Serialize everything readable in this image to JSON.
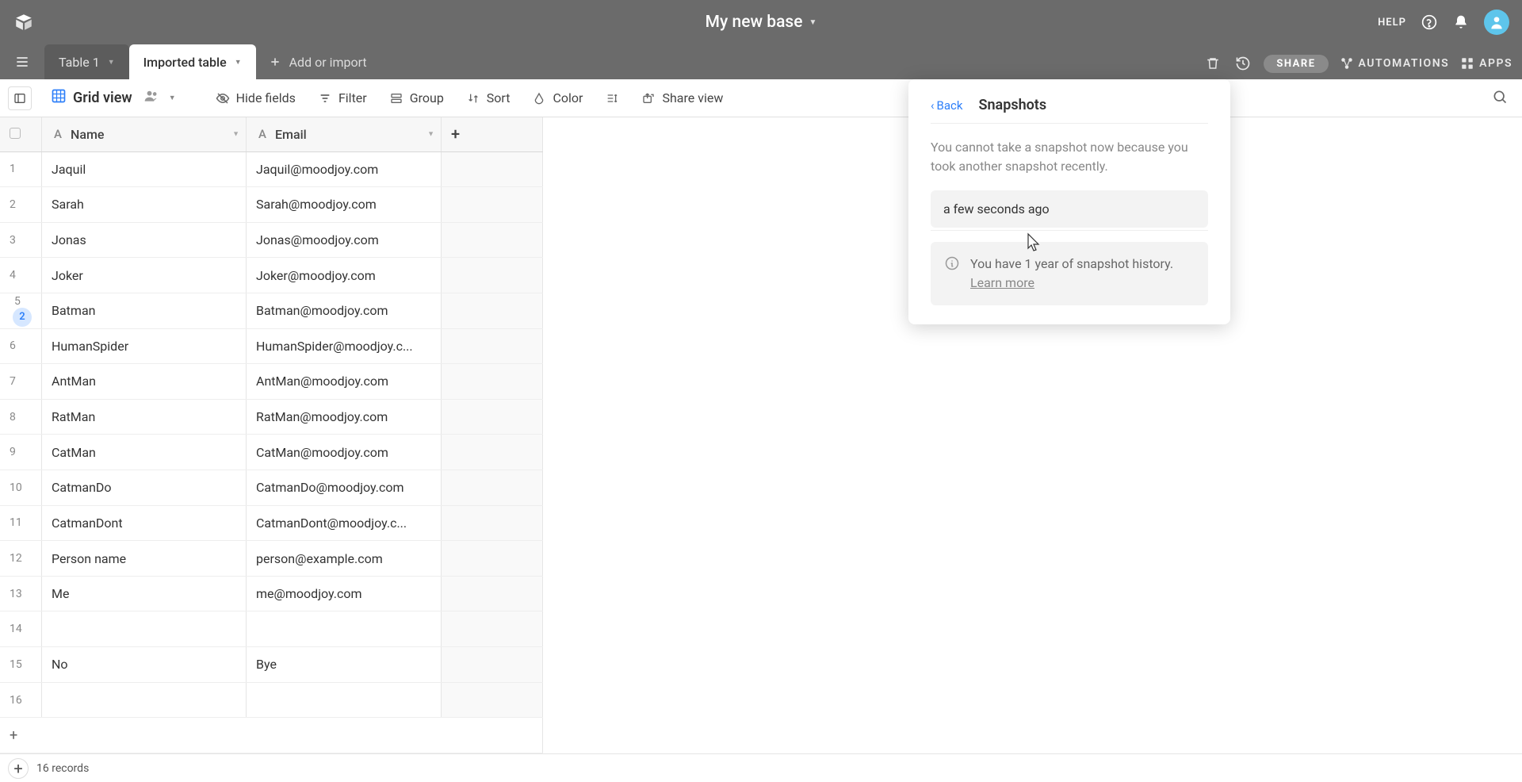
{
  "header": {
    "base_name": "My new base",
    "help_label": "HELP",
    "share_label": "SHARE",
    "automations_label": "AUTOMATIONS",
    "apps_label": "APPS"
  },
  "tabs": {
    "tab1": "Table 1",
    "tab2": "Imported table",
    "add_label": "Add or import"
  },
  "toolbar": {
    "view_name": "Grid view",
    "hide_fields": "Hide fields",
    "filter": "Filter",
    "group": "Group",
    "sort": "Sort",
    "color": "Color",
    "share_view": "Share view"
  },
  "columns": {
    "name": "Name",
    "email": "Email"
  },
  "rows": [
    {
      "num": "1",
      "name": "Jaquil",
      "email": "Jaquil@moodjoy.com"
    },
    {
      "num": "2",
      "name": "Sarah",
      "email": "Sarah@moodjoy.com"
    },
    {
      "num": "3",
      "name": "Jonas",
      "email": "Jonas@moodjoy.com"
    },
    {
      "num": "4",
      "name": "Joker",
      "email": "Joker@moodjoy.com"
    },
    {
      "num": "5",
      "name": "Batman",
      "email": "Batman@moodjoy.com",
      "badge": "2"
    },
    {
      "num": "6",
      "name": "HumanSpider",
      "email": "HumanSpider@moodjoy.c..."
    },
    {
      "num": "7",
      "name": "AntMan",
      "email": "AntMan@moodjoy.com"
    },
    {
      "num": "8",
      "name": "RatMan",
      "email": "RatMan@moodjoy.com"
    },
    {
      "num": "9",
      "name": "CatMan",
      "email": "CatMan@moodjoy.com"
    },
    {
      "num": "10",
      "name": "CatmanDo",
      "email": "CatmanDo@moodjoy.com"
    },
    {
      "num": "11",
      "name": "CatmanDont",
      "email": "CatmanDont@moodjoy.c..."
    },
    {
      "num": "12",
      "name": "Person name",
      "email": "person@example.com"
    },
    {
      "num": "13",
      "name": "Me",
      "email": "me@moodjoy.com"
    },
    {
      "num": "14",
      "name": "",
      "email": ""
    },
    {
      "num": "15",
      "name": "No",
      "email": "Bye"
    },
    {
      "num": "16",
      "name": "",
      "email": ""
    }
  ],
  "footer": {
    "record_count": "16 records"
  },
  "popover": {
    "back": "Back",
    "title": "Snapshots",
    "message": "You cannot take a snapshot now because you took another snapshot recently.",
    "snapshot_time": "a few seconds ago",
    "info_text": "You have 1 year of snapshot history. ",
    "learn_more": "Learn more"
  }
}
